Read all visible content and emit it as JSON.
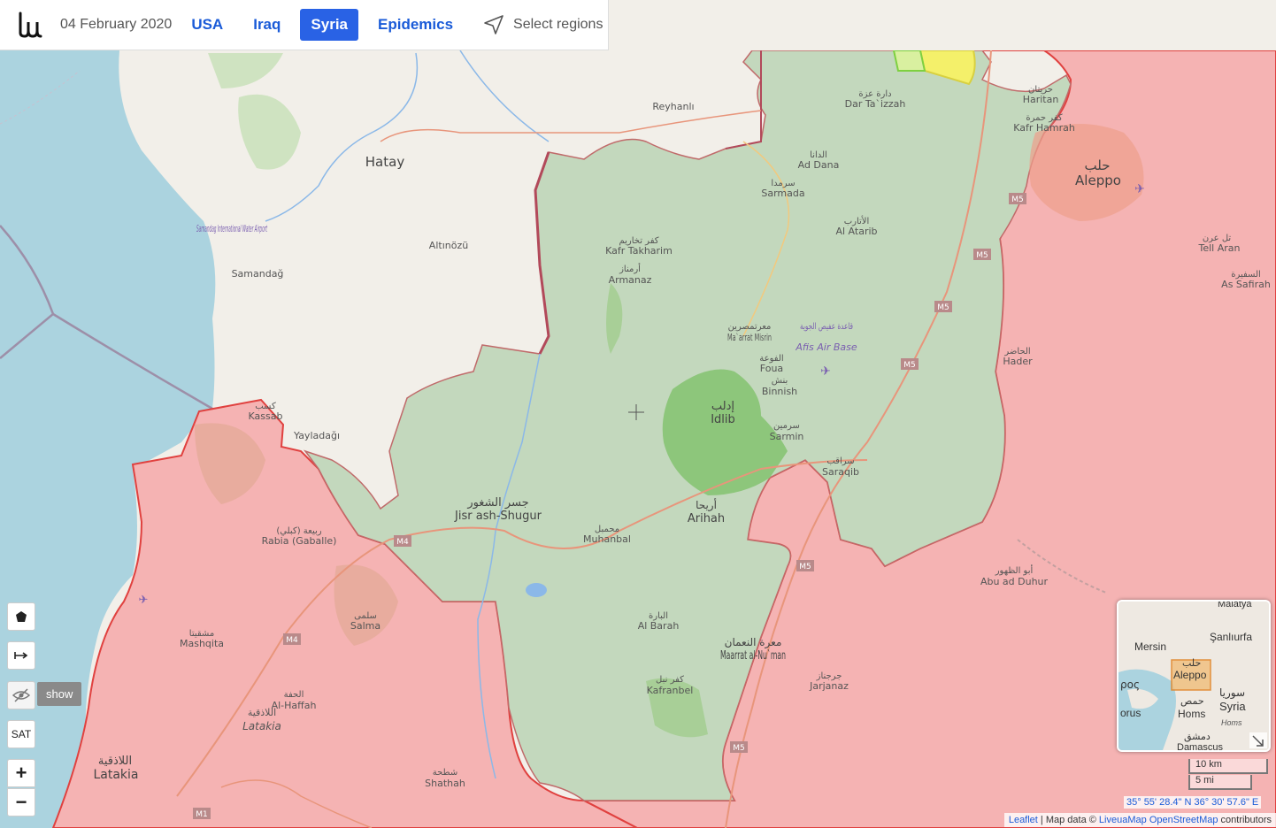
{
  "topbar": {
    "date": "04 February 2020",
    "nav": [
      "USA",
      "Iraq",
      "Syria",
      "Epidemics"
    ],
    "active": "Syria",
    "select_regions": "Select regions"
  },
  "controls": {
    "polygon": "polygon-icon",
    "measure": "measure-icon",
    "hide": "eye-off-icon",
    "show_tip": "show",
    "sat": "SAT",
    "zoom_in": "+",
    "zoom_out": "−"
  },
  "places": {
    "hatay": "Hatay",
    "reyhanli": "Reyhanlı",
    "altinozu": "Altınözü",
    "samandag": "Samandağ",
    "samandag_airport": "Samandag International Water Airport",
    "kassab_ar": "كسب",
    "kassab": "Kassab",
    "yayladagi": "Yayladağı",
    "aleppo_ar": "حلب",
    "aleppo": "Aleppo",
    "dar_taizzah_ar": "دارة عزة",
    "dar_taizzah": "Dar Ta`izzah",
    "haritan_ar": "حريتان",
    "haritan": "Haritan",
    "kafr_hamra_ar": "كفر حمرة",
    "kafr_hamra": "Kafr Hamrah",
    "ad_dana_ar": "الدانا",
    "ad_dana": "Ad Dana",
    "sarmada_ar": "سرمدا",
    "sarmada": "Sarmada",
    "al_atarib_ar": "الأتارب",
    "al_atarib": "Al Atarib",
    "kafr_takharim_ar": "كفر تخاريم",
    "kafr_takharim": "Kafr Takharim",
    "armanaz_ar": "أرمناز",
    "armanaz": "Armanaz",
    "tell_aran_ar": "تل عرن",
    "tell_aran": "Tell Aran",
    "as_safirah_ar": "السفيرة",
    "as_safirah": "As Safirah",
    "maarat_ar": "معرتمصرين",
    "maarat": "Ma`arrat Misrin",
    "afis_ar": "قاعدة عفيص الجوية",
    "afis": "Afis Air Base",
    "foua_ar": "الفوعة",
    "foua": "Foua",
    "binnish_ar": "بنش",
    "binnish": "Binnish",
    "hader_ar": "الحاضر",
    "hader": "Hader",
    "idlib_ar": "إدلب",
    "idlib": "Idlib",
    "sarmin_ar": "سرمين",
    "sarmin": "Sarmin",
    "saraqib_ar": "سراقب",
    "saraqib": "Saraqib",
    "jisr_ar": "جسر الشغور",
    "jisr": "Jisr ash-Shugur",
    "ariha_ar": "أريحا",
    "ariha": "Arihah",
    "muhanbal_ar": "محمبل",
    "muhanbal": "Muhanbal",
    "rabia_ar": "ربيعة (كبلي)",
    "rabia": "Rabia (Gaballe)",
    "abu_duhur_ar": "أبو الظهور",
    "abu_duhur": "Abu ad Duhur",
    "al_barah_ar": "البارة",
    "al_barah": "Al Barah",
    "salma_ar": "سلمى",
    "salma": "Salma",
    "mashqita_ar": "مشقيتا",
    "mashqita": "Mashqita",
    "maarat_numan_ar": "معرة النعمان",
    "maarat_numan": "Maarrat al-Nu`man",
    "jarjanaz_ar": "جرجناز",
    "jarjanaz": "Jarjanaz",
    "kafranbel_ar": "كفر نبل",
    "kafranbel": "Kafranbel",
    "al_haffah_ar": "الحفة",
    "al_haffah": "Al-Haffah",
    "latakia_gov_ar": "اللاذقية",
    "latakia_gov": "Latakia",
    "latakia_ar": "اللاذقية",
    "latakia": "Latakia",
    "shathah_ar": "شطحة",
    "shathah": "Shathah"
  },
  "roads": [
    "M5",
    "M5",
    "M5",
    "M5",
    "M4",
    "M4",
    "M5",
    "M5",
    "M1"
  ],
  "minimap": {
    "mersin": "Mersin",
    "sanliurfa": "Şanlıurfa",
    "malatya": "Malatya",
    "aleppo_ar": "حلب",
    "aleppo": "Aleppo",
    "syria_ar": "سوريا",
    "syria": "Syria",
    "homs_ar": "حمص",
    "homs": "Homs",
    "homs2": "Homs",
    "cyprus1": "ρος",
    "cyprus2": "orus",
    "damascus_ar": "دمشق",
    "damascus": "Damascus"
  },
  "scale": {
    "km": "10 km",
    "mi": "5 mi"
  },
  "coords": "35° 55' 28.4\" N 36° 30' 57.6\" E",
  "attribution": {
    "leaflet": "Leaflet",
    "sep1": " | Map data © ",
    "liveuamap": "LiveuaMap",
    "osm": "OpenStreetMap",
    "tail": " contributors"
  },
  "colors": {
    "sea": "#abd3df",
    "turkey": "#f2efe9",
    "rebel_green": "#c3d8bd",
    "government_red": "#f5b3b3",
    "border_red": "#e0413f",
    "forest": "#8dc67b",
    "accent_blue": "#2962e5"
  }
}
